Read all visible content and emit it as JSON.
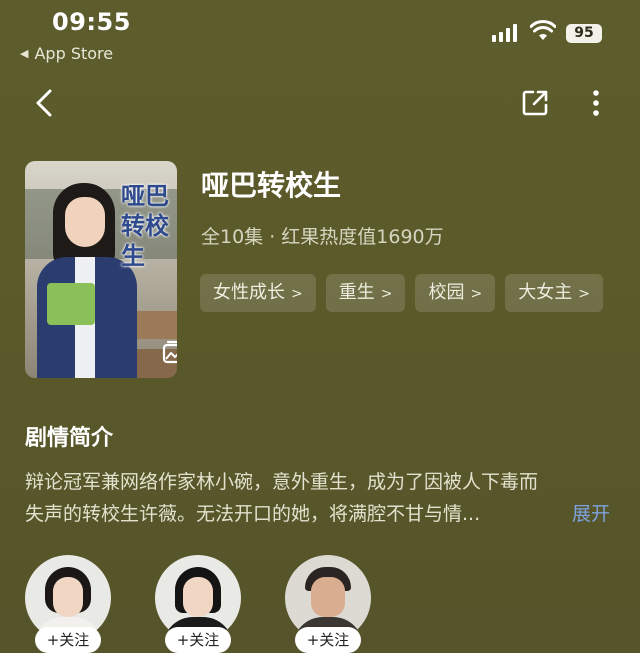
{
  "status_bar": {
    "time": "09:55",
    "back_app": "App Store",
    "battery": "95"
  },
  "show": {
    "title": "哑巴转校生",
    "meta": "全10集 · 红果热度值1690万",
    "cover_title": "哑巴转校生",
    "tags": [
      {
        "label": "女性成长"
      },
      {
        "label": "重生"
      },
      {
        "label": "校园"
      },
      {
        "label": "大女主"
      }
    ]
  },
  "synopsis": {
    "heading": "剧情简介",
    "line1": "辩论冠军兼网络作家林小碗，意外重生，成为了因被人下毒而",
    "line2": "失声的转校生许薇。无法开口的她，将满腔不甘与情...",
    "expand_label": "展开"
  },
  "cast": [
    {
      "follow_label": "+关注"
    },
    {
      "follow_label": "+关注"
    },
    {
      "follow_label": "+关注"
    }
  ],
  "colors": {
    "accent_link": "#7ea2dd",
    "background": "#5b5a2a"
  },
  "icons": [
    "back-icon",
    "share-icon",
    "more-icon",
    "gallery-icon",
    "wifi-icon",
    "signal-icon"
  ]
}
